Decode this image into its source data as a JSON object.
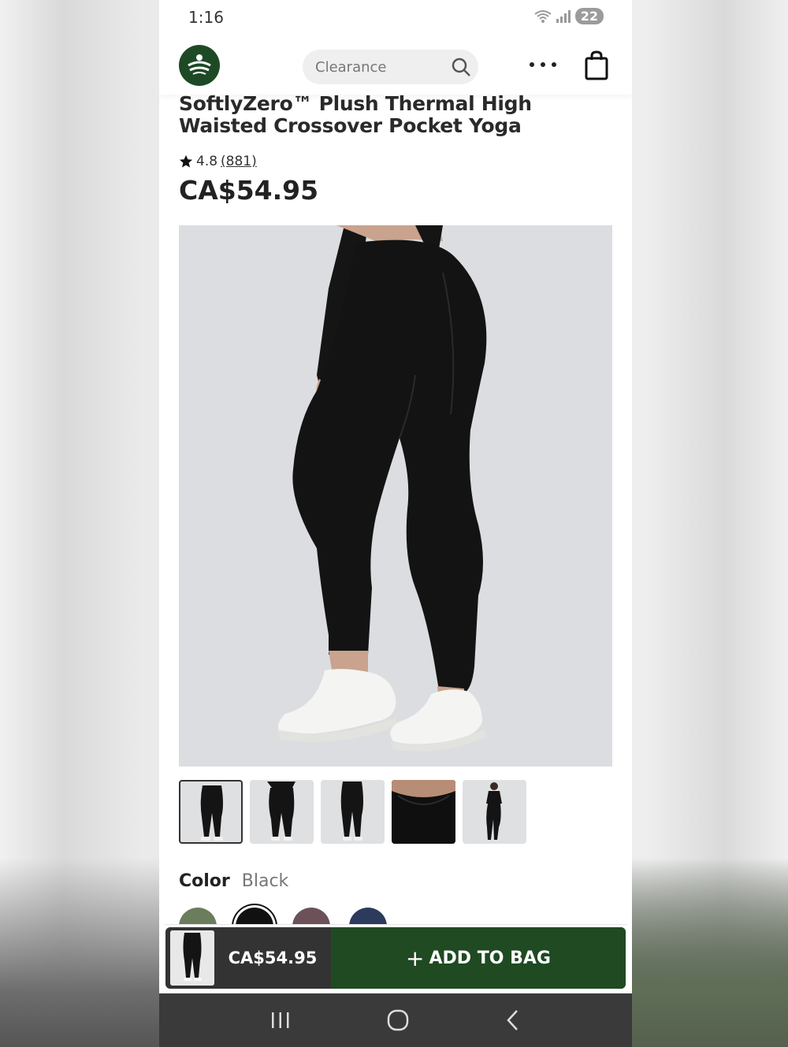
{
  "status_bar": {
    "time": "1:16",
    "battery": "22"
  },
  "header": {
    "search_placeholder": "Clearance",
    "brand_color": "#1d4a25"
  },
  "product": {
    "title": "SoftlyZero™ Plush Thermal High Waisted Crossover Pocket Yoga",
    "rating": "4.8",
    "review_count": "(881)",
    "price": "CA$54.95",
    "thumbnails": [
      "thumb-1",
      "thumb-2",
      "thumb-3",
      "thumb-4",
      "thumb-5"
    ],
    "color_label": "Color",
    "color_value": "Black",
    "swatches": [
      "#6b7d5c",
      "#111111",
      "#6d5158",
      "#2c3a5c"
    ]
  },
  "bag_bar": {
    "price": "CA$54.95",
    "add_label": "ADD TO BAG",
    "add_icon": "+",
    "button_color": "#1f4a22"
  },
  "nav_bar": {
    "icons": [
      "recent-apps-icon",
      "home-icon",
      "back-icon"
    ]
  }
}
